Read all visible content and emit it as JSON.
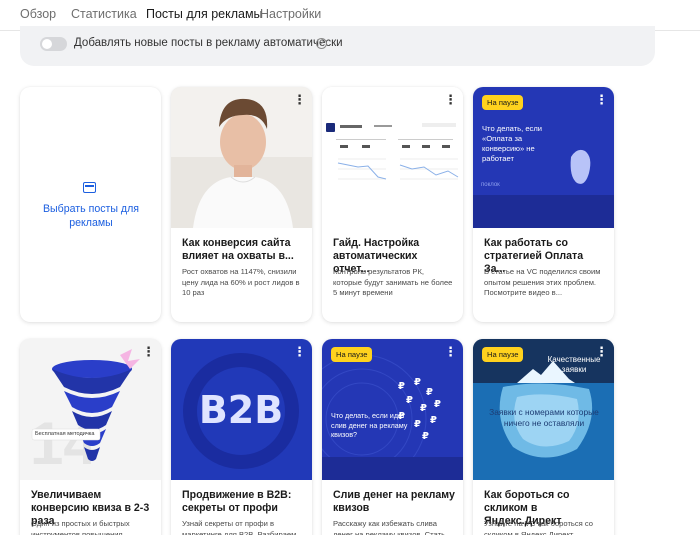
{
  "tabs": [
    {
      "label": "Обзор"
    },
    {
      "label": "Статистика"
    },
    {
      "label": "Посты для рекламы"
    },
    {
      "label": "Настройки"
    }
  ],
  "active_tab": "Посты для рекламы",
  "auto_add": {
    "label": "Добавлять новые посты в рекламу автоматически",
    "enabled": false,
    "help_symbol": "?"
  },
  "add_card": {
    "label": "Выбрать посты для рекламы"
  },
  "menu_symbol": "⋮",
  "posts": [
    {
      "title": "Как конверсия сайта влияет на охваты в...",
      "desc": "Рост охватов на 1147%, снизили цену лида на 60% и рост лидов в 10 раз",
      "paused": false
    },
    {
      "title": "Гайд. Настройка автоматических отчет...",
      "desc": "Контроль результатов РК, которые будут занимать не более 5 минут времени",
      "paused": false
    },
    {
      "title": "Как работать со стратегией Оплата За...",
      "desc": "В статье на VC поделился своим опытом решения этих проблем. Посмотрите видео в...",
      "paused": true,
      "badge": "На паузе",
      "image_text": "Что делать, если «Оплата за конверсию» не работает"
    },
    {
      "title": "Увеличиваем конверсию квиза в 2-3 раза",
      "desc": "Один из простых и быстрых инструментов повышения конверсии",
      "paused": false,
      "image_tag": "Бесплатная методичка"
    },
    {
      "title": "Продвижение в B2B: секреты от профи",
      "desc": "Узнай секреты от профи в маркетинге для B2B. Разбираем",
      "paused": false,
      "image_text": "B2B"
    },
    {
      "title": "Слив денег на рекламу квизов",
      "desc": "Расскажу как избежать слива денег на рекламу квизов. Стать",
      "paused": true,
      "badge": "На паузе",
      "image_text": "Что делать, если идет слив денег на рекламу квизов?"
    },
    {
      "title": "Как бороться со скликом в Яндекс.Директ",
      "desc": "Узнайте на VC как бороться со скликом в Яндекс Директ",
      "paused": true,
      "badge": "На паузе",
      "image_text": "Заявки с номерами которые ничего не оставляли",
      "image_text_top": "Качественные заявки"
    }
  ],
  "colors": {
    "accent": "#1c5fe0",
    "badge": "#ffd21e",
    "panel": "#f1f2f4",
    "dark_blue": "#1e2f9a"
  }
}
